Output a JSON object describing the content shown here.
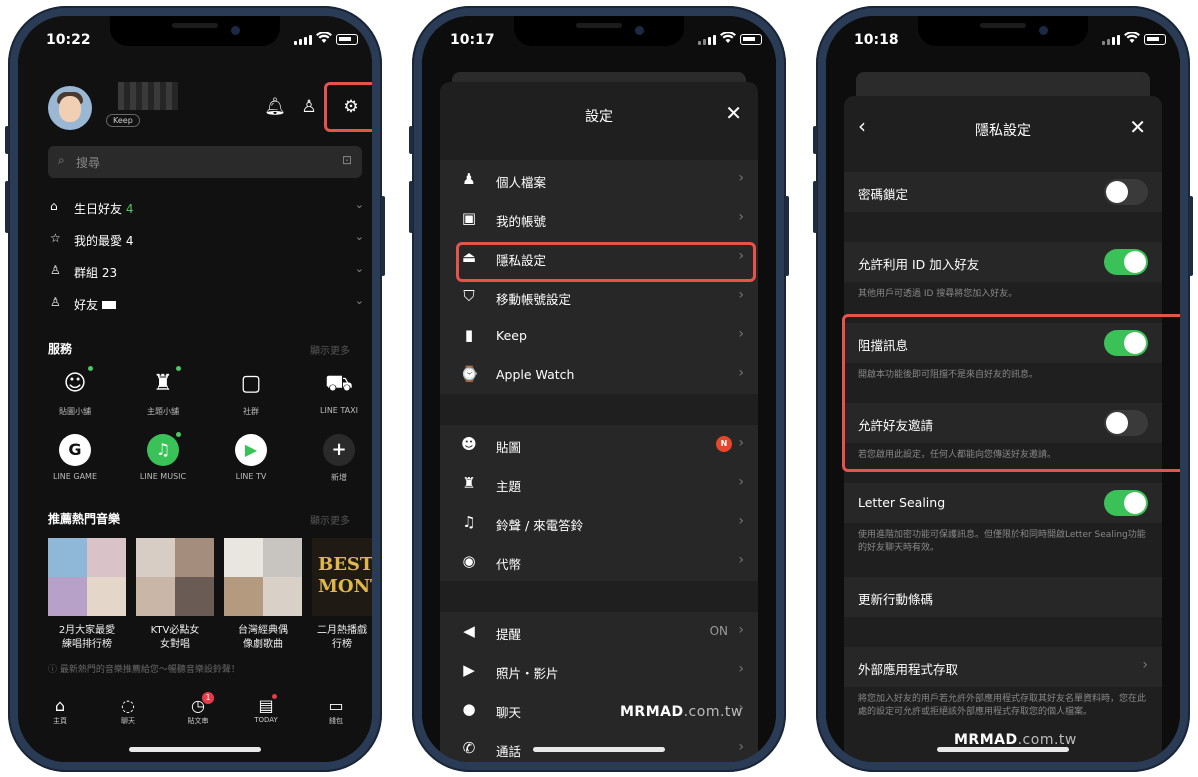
{
  "phone1": {
    "time": "10:22",
    "profile": {
      "keep_label": "Keep"
    },
    "search_placeholder": "搜尋",
    "groups": [
      {
        "label": "生日好友",
        "count": "4",
        "icon": "cake-icon",
        "glyph": "⌂"
      },
      {
        "label": "我的最愛",
        "count": "4",
        "icon": "star-icon",
        "glyph": "☆"
      },
      {
        "label": "群組",
        "count": "23",
        "icon": "group-icon",
        "glyph": "♙"
      },
      {
        "label": "好友",
        "count": "",
        "icon": "person-icon",
        "glyph": "♙"
      }
    ],
    "services_title": "服務",
    "services_more": "顯示更多",
    "services": [
      {
        "label": "貼圖小舖",
        "glyph": "☺",
        "icon": "sticker-shop-icon",
        "dot": true
      },
      {
        "label": "主題小舖",
        "glyph": "♜",
        "icon": "theme-shop-icon",
        "dot": true
      },
      {
        "label": "社群",
        "glyph": "▢",
        "icon": "openchat-icon",
        "dot": false
      },
      {
        "label": "LINE TAXI",
        "glyph": "⛟",
        "icon": "taxi-icon",
        "dot": false
      },
      {
        "label": "LINE GAME",
        "glyph": "G",
        "icon": "line-game-icon",
        "dot": false
      },
      {
        "label": "LINE MUSIC",
        "glyph": "♫",
        "icon": "line-music-icon",
        "dot": false
      },
      {
        "label": "LINE TV",
        "glyph": "▶",
        "icon": "line-tv-icon",
        "dot": false
      },
      {
        "label": "新增",
        "glyph": "+",
        "icon": "add-service-icon",
        "dot": false
      }
    ],
    "music_title": "推薦熱門音樂",
    "music_more": "顯示更多",
    "albums": [
      {
        "line1": "2月大家最愛",
        "line2": "練唱排行榜",
        "colors": [
          "#8fb7d8",
          "#d9c3c8",
          "#b7a1c9",
          "#e5d6ca"
        ]
      },
      {
        "line1": "KTV必點女",
        "line2": "女對唱",
        "colors": [
          "#d8cdc4",
          "#a58d7e",
          "#c9b6a6",
          "#6b5b55"
        ]
      },
      {
        "line1": "台灣經典偶",
        "line2": "像劇歌曲",
        "colors": [
          "#e9e6e0",
          "#c8c4c0",
          "#b49a7e",
          "#d9d1c8"
        ]
      },
      {
        "line1": "二月熱播戲",
        "line2": "行榜",
        "colors": [
          "#2b2418",
          "#c9a13a",
          "#1d1a14",
          "#e0b84a"
        ]
      }
    ],
    "best_month": "BEST MONTH",
    "tip": "ⓘ 最新熱門的音樂推薦給您～暢聽音樂設鈴聲！",
    "tabs": [
      {
        "label": "主頁",
        "glyph": "⌂",
        "icon": "home-icon"
      },
      {
        "label": "聊天",
        "glyph": "◌",
        "icon": "chat-icon"
      },
      {
        "label": "貼文串",
        "glyph": "◷",
        "icon": "timeline-icon",
        "badge": "1"
      },
      {
        "label": "TODAY",
        "glyph": "▤",
        "icon": "today-icon"
      },
      {
        "label": "錢包",
        "glyph": "▭",
        "icon": "wallet-icon"
      }
    ]
  },
  "phone2": {
    "time": "10:17",
    "title": "設定",
    "group1": [
      {
        "label": "個人檔案",
        "glyph": "♟",
        "icon": "profile-icon"
      },
      {
        "label": "我的帳號",
        "glyph": "▣",
        "icon": "account-icon"
      },
      {
        "label": "隱私設定",
        "glyph": "⏏",
        "icon": "privacy-lock-icon"
      },
      {
        "label": "移動帳號設定",
        "glyph": "⛉",
        "icon": "shield-icon"
      },
      {
        "label": "Keep",
        "glyph": "▮",
        "icon": "bookmark-icon"
      },
      {
        "label": "Apple Watch",
        "glyph": "⌚",
        "icon": "watch-icon"
      }
    ],
    "group2": [
      {
        "label": "貼圖",
        "glyph": "☻",
        "icon": "sticker-icon",
        "badge": "N"
      },
      {
        "label": "主題",
        "glyph": "♜",
        "icon": "theme-icon"
      },
      {
        "label": "鈴聲 / 來電答鈴",
        "glyph": "♫",
        "icon": "ringtone-icon"
      },
      {
        "label": "代幣",
        "glyph": "◉",
        "icon": "coin-icon"
      }
    ],
    "group3": [
      {
        "label": "提醒",
        "glyph": "◀",
        "icon": "notification-speaker-icon",
        "value": "ON"
      },
      {
        "label": "照片・影片",
        "glyph": "▶",
        "icon": "photo-video-icon"
      },
      {
        "label": "聊天",
        "glyph": "●",
        "icon": "chat-bubble-icon"
      },
      {
        "label": "通話",
        "glyph": "✆",
        "icon": "phone-call-icon"
      }
    ],
    "watermark_bold": "MRMAD",
    "watermark_rest": ".com.tw"
  },
  "phone3": {
    "time": "10:18",
    "title": "隱私設定",
    "passcode": {
      "label": "密碼鎖定",
      "on": false
    },
    "allow_id": {
      "label": "允許利用 ID 加入好友",
      "on": true,
      "desc": "其他用戶可透過 ID 搜尋將您加入好友。"
    },
    "block_messages": {
      "label": "阻擋訊息",
      "on": true,
      "desc": "開啟本功能後即可阻擋不是來自好友的訊息。"
    },
    "allow_invites": {
      "label": "允許好友邀請",
      "on": false,
      "desc": "若您啟用此設定，任何人都能向您傳送好友邀請。"
    },
    "letter_sealing": {
      "label": "Letter Sealing",
      "on": true,
      "desc": "使用進階加密功能可保護訊息。但僅限於和同時開啟Letter Sealing功能的好友聊天時有效。"
    },
    "update_qr": {
      "label": "更新行動條碼"
    },
    "external_apps": {
      "label": "外部應用程式存取",
      "desc": "將您加入好友的用戶若允許外部應用程式存取其好友名單資料時，您在此處的設定可允許或拒絕該外部應用程式存取您的個人檔案。"
    },
    "watermark_bold": "MRMAD",
    "watermark_rest": ".com.tw"
  }
}
